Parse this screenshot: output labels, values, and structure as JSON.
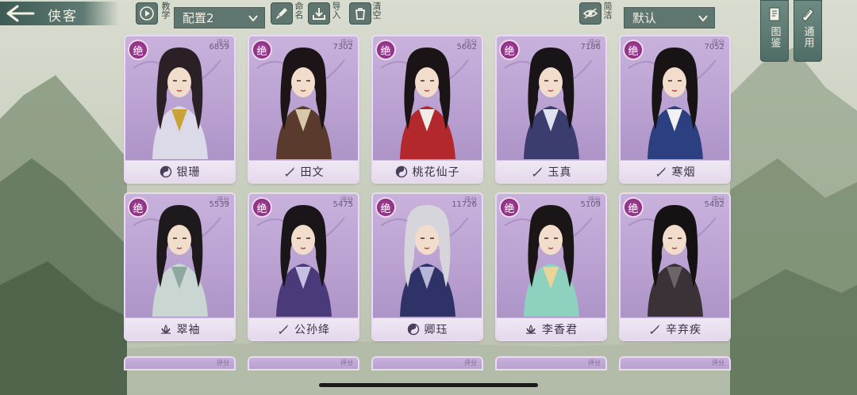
{
  "header": {
    "title": "侠客",
    "tutorial_label": "教学",
    "config_select": "配置2",
    "rename_label": "命名",
    "import_label": "导入",
    "clear_label": "清空",
    "simple_label": "简洁",
    "sort_select": "默认",
    "atlas_label": "图鉴",
    "general_label": "通用"
  },
  "score_label": "评分",
  "cards": [
    {
      "rank": "绝",
      "score": "6859",
      "name": "银珊",
      "faction": "yin-yang-icon",
      "robe": "#dcd9e8",
      "hair": "#2a2026",
      "accent": "#c9a23a"
    },
    {
      "rank": "绝",
      "score": "7302",
      "name": "田文",
      "faction": "sword-icon",
      "robe": "#5b3a2e",
      "hair": "#1c1416",
      "accent": "#d6c7a8"
    },
    {
      "rank": "绝",
      "score": "5662",
      "name": "桃花仙子",
      "faction": "yin-yang-icon",
      "robe": "#b2282c",
      "hair": "#1a1416",
      "accent": "#f1ede6"
    },
    {
      "rank": "绝",
      "score": "7186",
      "name": "玉真",
      "faction": "sword-icon",
      "robe": "#3b3d6e",
      "hair": "#181418",
      "accent": "#e0e2f0"
    },
    {
      "rank": "绝",
      "score": "7052",
      "name": "寒烟",
      "faction": "sword-icon",
      "robe": "#2c3f80",
      "hair": "#181416",
      "accent": "#f2f2f4"
    },
    {
      "rank": "绝",
      "score": "5539",
      "name": "翠袖",
      "faction": "lotus-icon",
      "robe": "#c9d6d2",
      "hair": "#1d191c",
      "accent": "#8fa7a1"
    },
    {
      "rank": "绝",
      "score": "5475",
      "name": "公孙绛",
      "faction": "sword-icon",
      "robe": "#4a3a7a",
      "hair": "#1a1519",
      "accent": "#c7c0e0"
    },
    {
      "rank": "绝",
      "score": "11726",
      "name": "卿珏",
      "faction": "yin-yang-icon",
      "robe": "#2f3266",
      "hair": "#d7d5dc",
      "accent": "#b8b6d8"
    },
    {
      "rank": "绝",
      "score": "5109",
      "name": "李香君",
      "faction": "lotus-icon",
      "robe": "#8fd1bf",
      "hair": "#1a1618",
      "accent": "#e9d59a"
    },
    {
      "rank": "绝",
      "score": "5482",
      "name": "辛弃疾",
      "faction": "sword-icon",
      "robe": "#3a3236",
      "hair": "#151214",
      "accent": "#6b6468"
    }
  ]
}
